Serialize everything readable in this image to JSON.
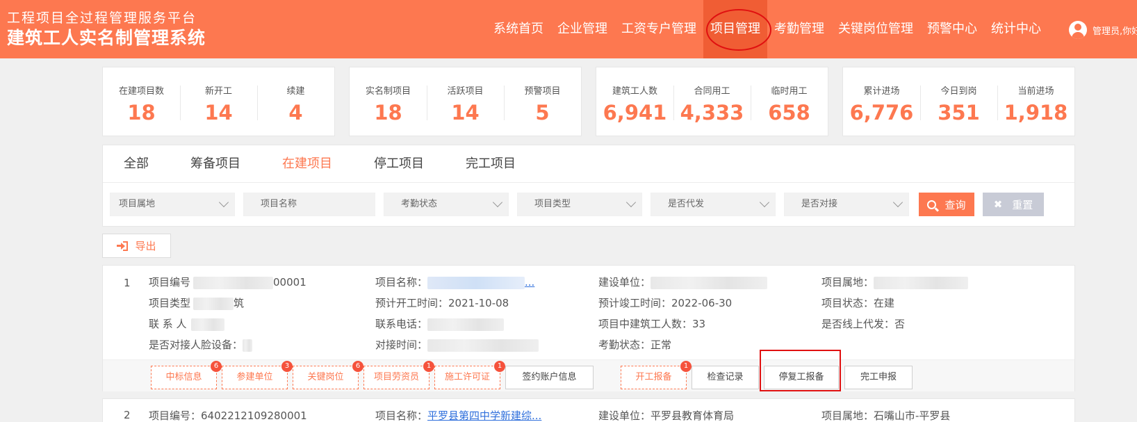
{
  "header": {
    "subtitle": "工程项目全过程管理服务平台",
    "title": "建筑工人实名制管理系统",
    "nav": [
      "系统首页",
      "企业管理",
      "工资专户管理",
      "项目管理",
      "考勤管理",
      "关键岗位管理",
      "预警中心",
      "统计中心"
    ],
    "active_nav": "项目管理",
    "user_label": "管理员,你好"
  },
  "stats": [
    [
      {
        "label": "在建项目数",
        "value": "18"
      },
      {
        "label": "新开工",
        "value": "14"
      },
      {
        "label": "续建",
        "value": "4"
      }
    ],
    [
      {
        "label": "实名制项目",
        "value": "18"
      },
      {
        "label": "活跃项目",
        "value": "14"
      },
      {
        "label": "预警项目",
        "value": "5"
      }
    ],
    [
      {
        "label": "建筑工人数",
        "value": "6,941"
      },
      {
        "label": "合同用工",
        "value": "4,333"
      },
      {
        "label": "临时用工",
        "value": "658"
      }
    ],
    [
      {
        "label": "累计进场",
        "value": "6,776"
      },
      {
        "label": "今日到岗",
        "value": "351"
      },
      {
        "label": "当前进场",
        "value": "1,918"
      }
    ]
  ],
  "tabs": [
    "全部",
    "筹备项目",
    "在建项目",
    "停工项目",
    "完工项目"
  ],
  "active_tab": "在建项目",
  "filters": {
    "location": "项目属地",
    "name_placeholder": "项目名称",
    "attendance": "考勤状态",
    "type": "项目类型",
    "proxy": "是否代发",
    "connect": "是否对接",
    "query": "查询",
    "reset": "重置"
  },
  "export_label": "导出",
  "projects": [
    {
      "index": "1",
      "code_label": "项目编号",
      "code_value": "00001",
      "name_label": "项目名称：",
      "name_value": "...",
      "builder_label": "建设单位：",
      "location_label": "项目属地：",
      "type_label": "项目类型",
      "type_value": "筑",
      "start_label": "预计开工时间：",
      "start_value": "2021-10-08",
      "end_label": "预计竣工时间：",
      "end_value": "2022-06-30",
      "status_label": "项目状态：",
      "status_value": "在建",
      "contact_label": "联 系 人",
      "phone_label": "联系电话：",
      "workers_label": "项目中建筑工人数：",
      "workers_value": "33",
      "online_label": "是否线上代发：",
      "online_value": "否",
      "face_label": "是否对接人脸设备：",
      "connect_time_label": "对接时间：",
      "attendance_label": "考勤状态：",
      "attendance_value": "正常",
      "actions": [
        {
          "label": "中标信息",
          "badge": "6"
        },
        {
          "label": "参建单位",
          "badge": "3"
        },
        {
          "label": "关键岗位",
          "badge": "6"
        },
        {
          "label": "项目劳资员",
          "badge": "1"
        },
        {
          "label": "施工许可证",
          "badge": "1"
        },
        {
          "label": "签约账户信息",
          "badge": ""
        },
        {
          "label": "开工报备",
          "badge": "1"
        },
        {
          "label": "检查记录",
          "badge": ""
        },
        {
          "label": "停复工报备",
          "badge": ""
        },
        {
          "label": "完工申报",
          "badge": ""
        }
      ]
    },
    {
      "index": "2",
      "code_label": "项目编号：",
      "code_value": "6402212109280001",
      "name_label": "项目名称：",
      "name_value": "平罗县第四中学新建综...",
      "builder_label": "建设单位：",
      "builder_value": "平罗县教育体育局",
      "location_label": "项目属地：",
      "location_value": "石嘴山市-平罗县"
    }
  ]
}
